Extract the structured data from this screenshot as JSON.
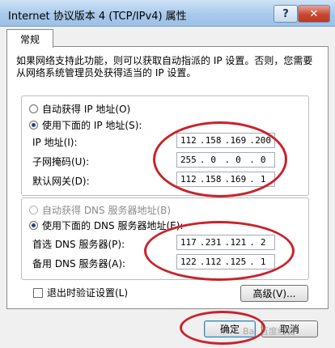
{
  "window": {
    "title": "Internet 协议版本 4 (TCP/IPv4) 属性",
    "help_glyph": "?",
    "close_glyph": "✕"
  },
  "tab": {
    "label": "常规"
  },
  "description": "如果网络支持此功能，则可以获取自动指派的 IP 设置。否则，您需要从网络系统管理员处获得适当的 IP 设置。",
  "ip": {
    "auto_label": "自动获得 IP 地址(O)",
    "manual_label": "使用下面的 IP 地址(S):",
    "fields": [
      {
        "label": "IP 地址(I):",
        "octets": [
          "112",
          "158",
          "169",
          "200"
        ]
      },
      {
        "label": "子网掩码(U):",
        "octets": [
          "255",
          "0",
          "0",
          "0"
        ]
      },
      {
        "label": "默认网关(D):",
        "octets": [
          "112",
          "158",
          "169",
          "1"
        ]
      }
    ]
  },
  "dns": {
    "auto_label": "自动获得 DNS 服务器地址(B)",
    "manual_label": "使用下面的 DNS 服务器地址(E):",
    "fields": [
      {
        "label": "首选 DNS 服务器(P):",
        "octets": [
          "117",
          "231",
          "121",
          "2"
        ]
      },
      {
        "label": "备用 DNS 服务器(A):",
        "octets": [
          "122",
          "112",
          "125",
          "1"
        ]
      }
    ]
  },
  "validate_label": "退出时验证设置(L)",
  "buttons": {
    "advanced": "高级(V)...",
    "ok": "确定",
    "cancel": "取消"
  },
  "watermark": "Bai 百度经验",
  "colors": {
    "annotation": "#c8232c"
  }
}
